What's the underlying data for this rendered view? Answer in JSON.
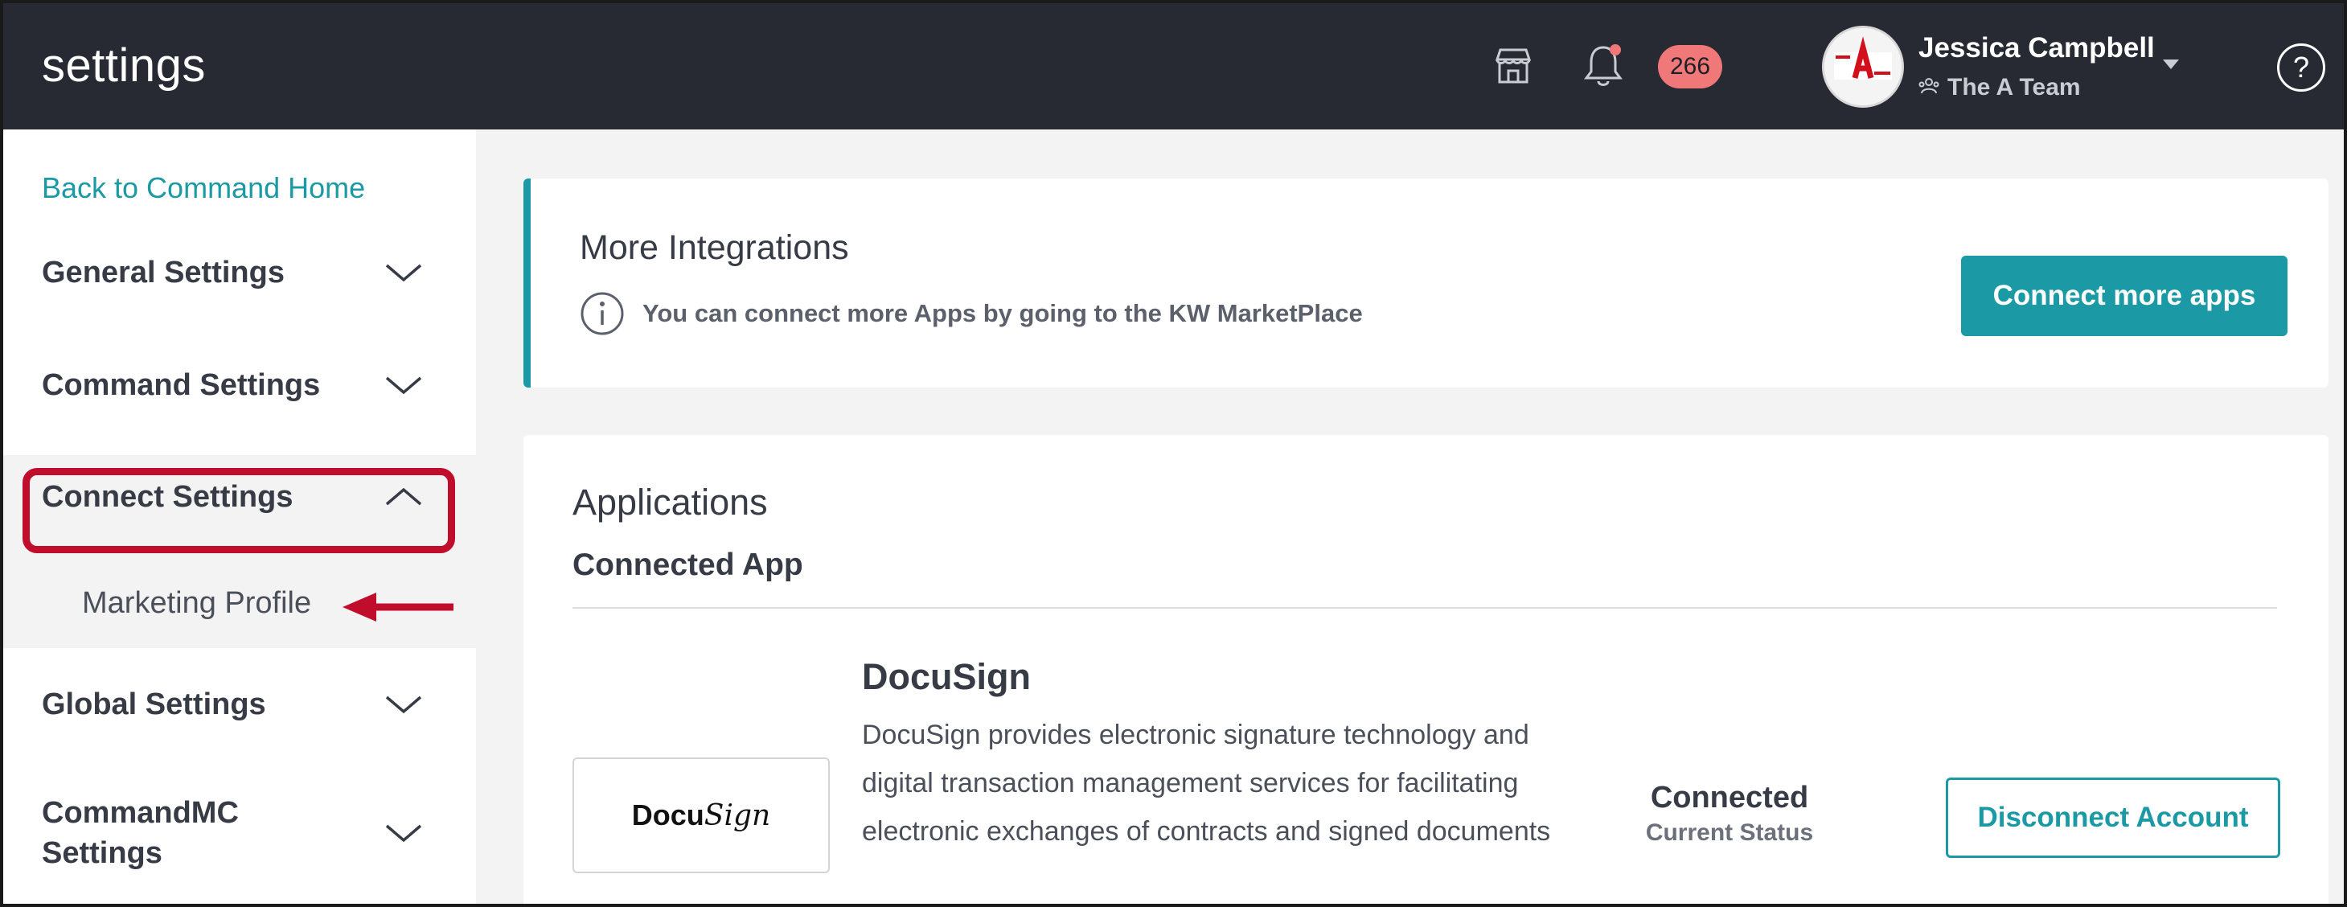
{
  "header": {
    "title": "settings",
    "store_icon": "storefront-icon",
    "bell_icon": "bell-icon",
    "notification_count": "266",
    "user_name": "Jessica Campbell",
    "team_name": "The A Team",
    "help_icon": "question-circle-icon"
  },
  "sidebar": {
    "back_link": "Back to Command Home",
    "items": [
      {
        "label": "General Settings",
        "expanded": false
      },
      {
        "label": "Command Settings",
        "expanded": false
      },
      {
        "label": "Connect Settings",
        "expanded": true
      },
      {
        "label": "Global Settings",
        "expanded": false
      },
      {
        "label": "CommandMC Settings",
        "expanded": false
      }
    ],
    "sub_item": "Marketing Profile"
  },
  "more_integrations": {
    "title": "More Integrations",
    "info": "You can connect more Apps by going to the KW MarketPlace",
    "button": "Connect more apps"
  },
  "applications": {
    "title": "Applications",
    "subtitle": "Connected App",
    "app": {
      "name": "DocuSign",
      "logo_text_bold": "Docu",
      "logo_text_script": "Sign",
      "description": "DocuSign provides electronic signature technology and digital transaction management services for facilitating electronic exchanges of contracts and signed documents",
      "status": "Connected",
      "status_label": "Current Status",
      "button": "Disconnect Account"
    }
  },
  "colors": {
    "topbar": "#272a33",
    "accent": "#1b9aa5",
    "badge": "#f07878",
    "highlight": "#c10d2c"
  }
}
